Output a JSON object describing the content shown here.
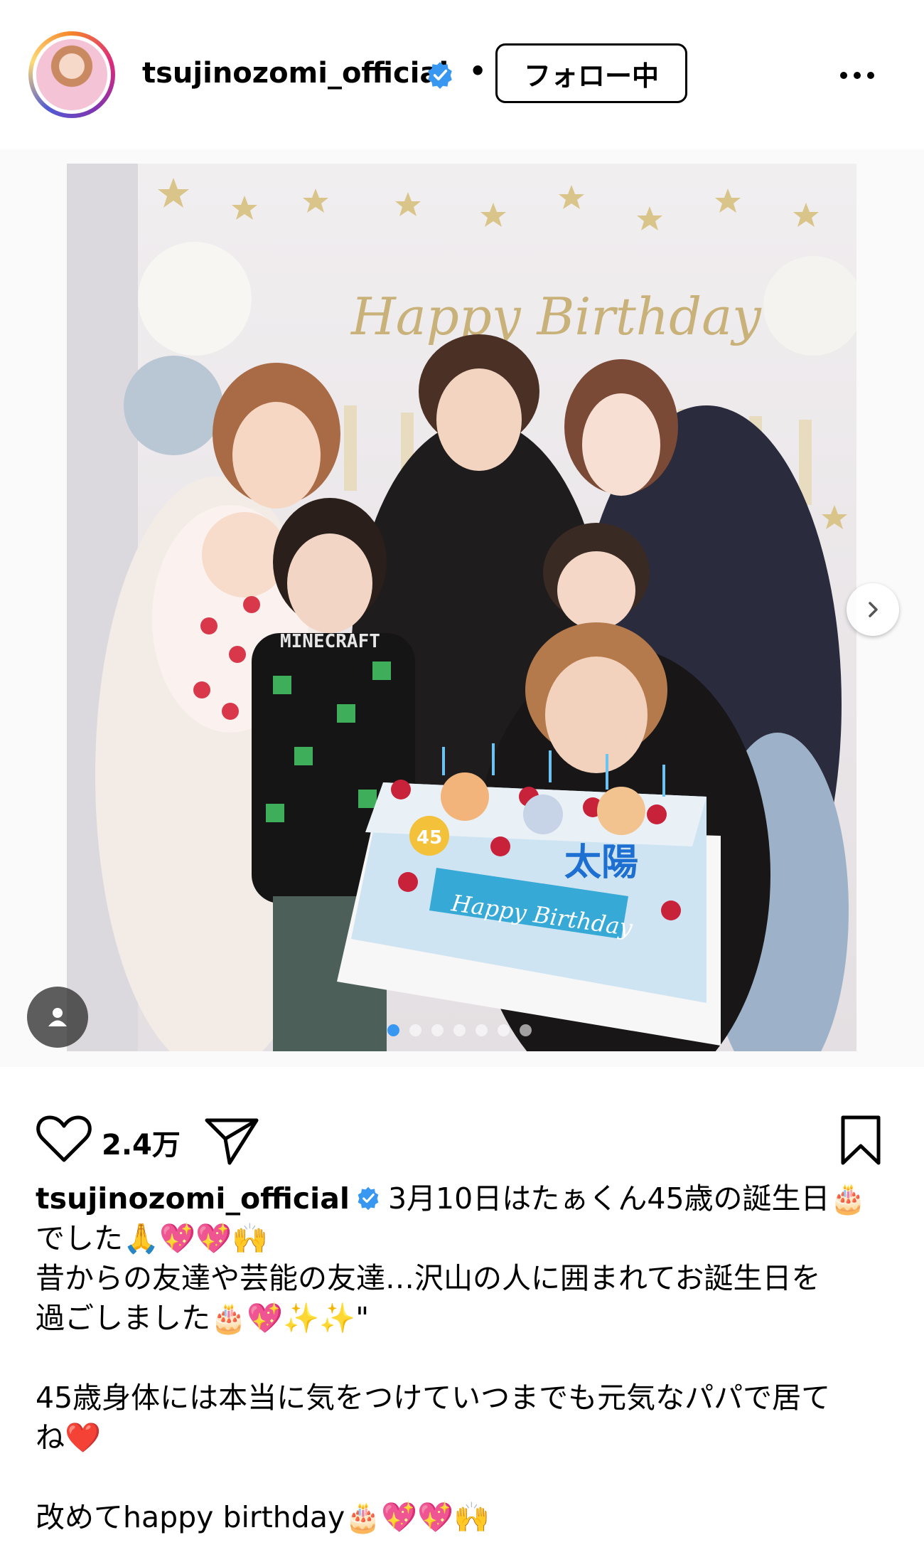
{
  "header": {
    "username": "tsujinozomi_official",
    "separator": "•",
    "follow_label": "フォロー中",
    "avatar_icon": "profile-avatar-icon",
    "more_icon": "more-options-icon"
  },
  "media": {
    "carousel_count": 7,
    "active_index": 0,
    "photo_cake_text_1": "Happy Birthday",
    "photo_cake_text_2": "太陽",
    "photo_cake_number": "45",
    "photo_banner_text": "Happy Birthday",
    "photo_shirt_text": "MINECRAFT"
  },
  "actions": {
    "like_count": "2.4万",
    "like_icon": "heart-icon",
    "share_icon": "send-icon",
    "save_icon": "bookmark-icon"
  },
  "caption": {
    "username": "tsujinozomi_official",
    "line1": "3月10日はたぁくん45歳の誕生日🎂",
    "line2": "でした🙏💖💖🙌",
    "line3": "昔からの友達や芸能の友達…沢山の人に囲まれてお誕生日を",
    "line4": "過ごしました🎂💖✨✨\"",
    "line5": "45歳身体には本当に気をつけていつまでも元気なパパで居て",
    "line6": "ね❤️",
    "line7": "改めてhappy birthday🎂💖💖🙌"
  },
  "colors": {
    "verified_blue": "#3897f0",
    "active_dot": "#3897f0"
  }
}
